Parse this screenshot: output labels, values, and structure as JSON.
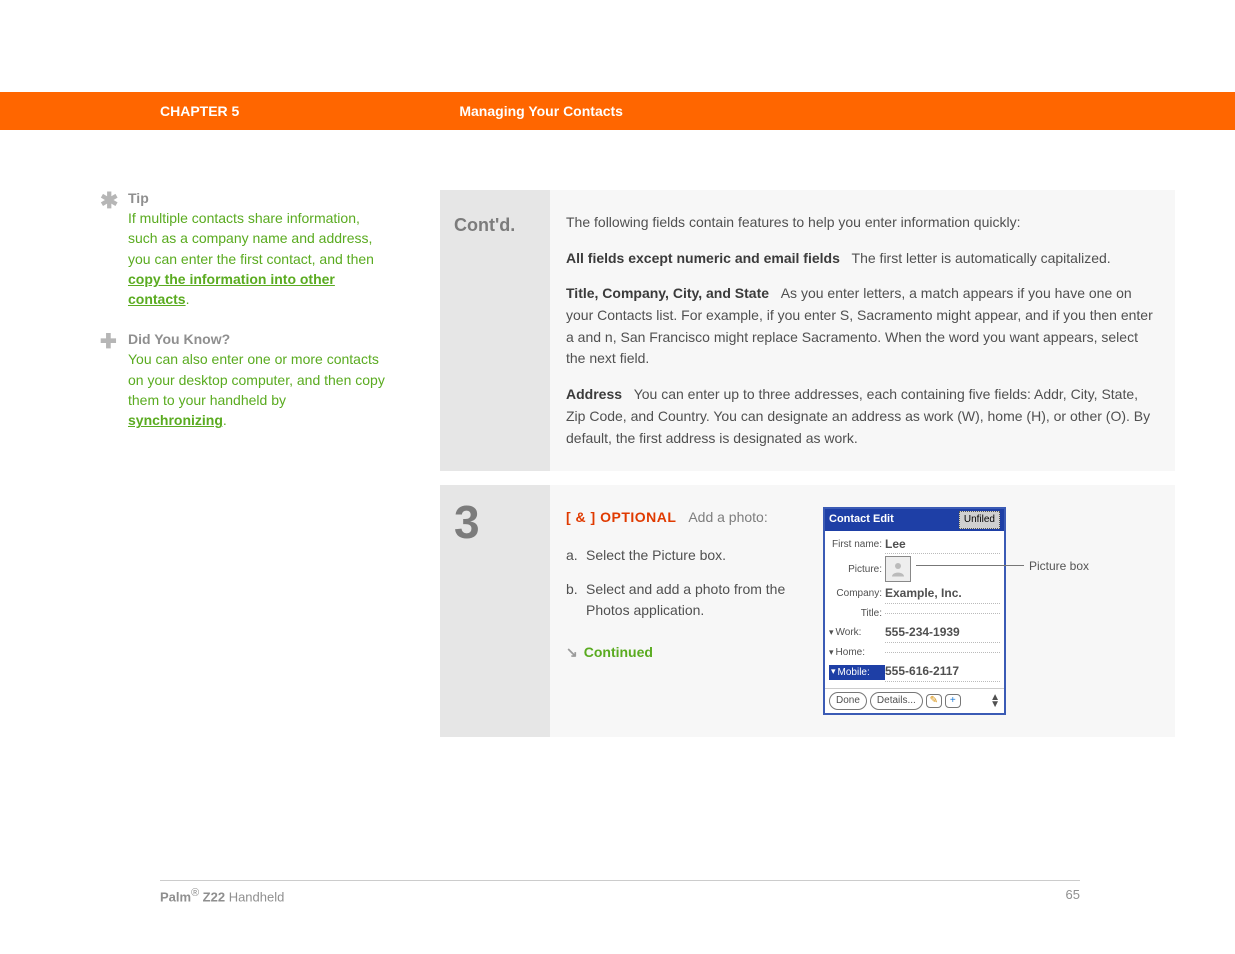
{
  "header": {
    "chapter_label": "CHAPTER 5",
    "chapter_title": "Managing Your Contacts"
  },
  "sidebar": {
    "tip": {
      "title": "Tip",
      "body_pre": "If multiple contacts share information, such as a company name and address, you can enter the first contact, and then ",
      "link": "copy the information into other contacts",
      "body_post": "."
    },
    "dyk": {
      "title": "Did You Know?",
      "body_pre": "You can also enter one or more contacts on your desktop computer, and then copy them to your handheld by ",
      "link": "synchronizing",
      "body_post": "."
    }
  },
  "main": {
    "contd_label": "Cont'd.",
    "intro": "The following fields contain features to help you enter information quickly:",
    "f1_label": "All fields except numeric and email fields",
    "f1_text": "The first letter is automatically capitalized.",
    "f2_label": "Title, Company, City, and State",
    "f2_text": "As you enter letters, a match appears if you have one on your Contacts list. For example, if you enter S, Sacramento might appear, and if you then enter a and n, San Francisco might replace Sacramento. When the word you want appears, select the next field.",
    "f3_label": "Address",
    "f3_text": "You can enter up to three addresses, each containing five fields: Addr, City, State, Zip Code, and Country. You can designate an address as work (W), home (H), or other (O). By default, the first address is designated as work.",
    "step3": {
      "num": "3",
      "optional_badge": "[ & ]  OPTIONAL",
      "optional_text": "Add a photo:",
      "sub_a_lbl": "a.",
      "sub_a": "Select the Picture box.",
      "sub_b_lbl": "b.",
      "sub_b": "Select and add a photo from the Photos application.",
      "continued": "Continued"
    },
    "screenshot": {
      "title": "Contact Edit",
      "category": "Unfiled",
      "firstname_lbl": "First name:",
      "firstname": "Lee",
      "picture_lbl": "Picture:",
      "company_lbl": "Company:",
      "company": "Example, Inc.",
      "title_lbl": "Title:",
      "title_val": "",
      "work_lbl": "Work:",
      "work_val": "555-234-1939",
      "home_lbl": "Home:",
      "home_val": "",
      "mobile_lbl": "Mobile:",
      "mobile_val": "555-616-2117",
      "done": "Done",
      "details": "Details...",
      "note_icon": "✎",
      "plus_icon": "+",
      "callout": "Picture box"
    }
  },
  "footer": {
    "product_bold": "Palm",
    "reg": "®",
    "product_model_bold": " Z22",
    "product_rest": " Handheld",
    "page": "65"
  }
}
